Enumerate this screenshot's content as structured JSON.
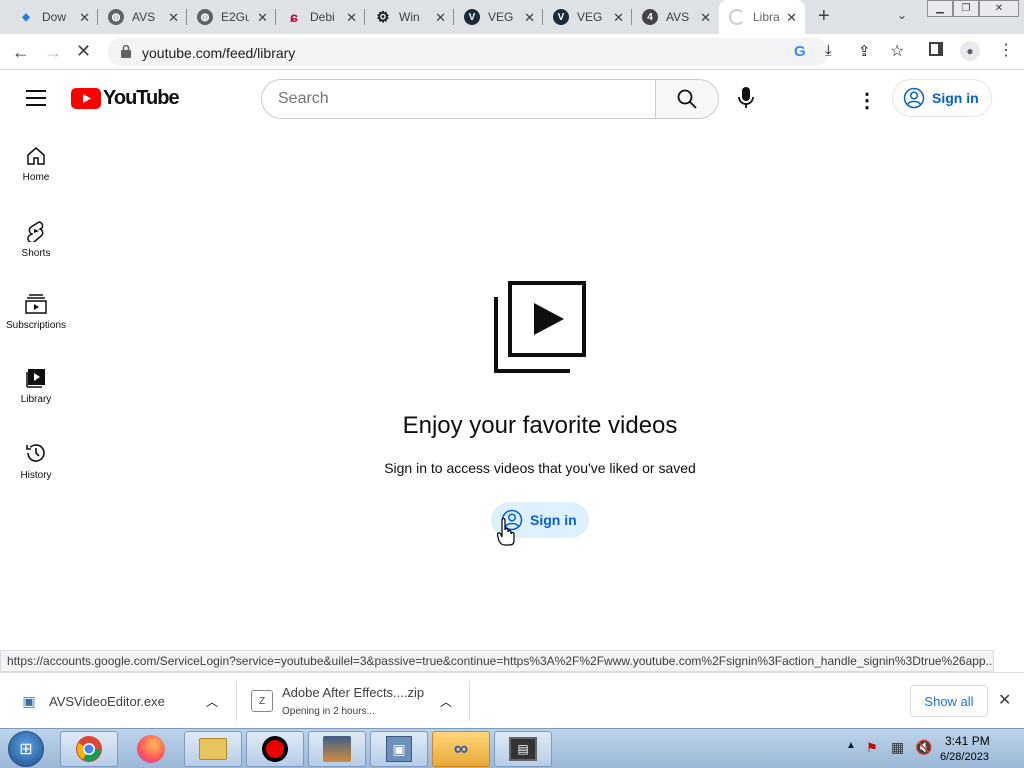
{
  "tabs": [
    {
      "title": "Dow",
      "icon": "diamond-icon",
      "color": "#2b7bd8"
    },
    {
      "title": "AVS",
      "icon": "globe-icon",
      "color": "#5f6368"
    },
    {
      "title": "E2Gu",
      "icon": "globe-icon",
      "color": "#5f6368"
    },
    {
      "title": "Debi",
      "icon": "debian-swirl-icon",
      "color": "#c70036"
    },
    {
      "title": "Win",
      "icon": "gear-icon",
      "color": "#202124"
    },
    {
      "title": "VEG",
      "icon": "vegas-icon",
      "color": "#1b2a3a"
    },
    {
      "title": "VEG",
      "icon": "vegas-icon",
      "color": "#1b2a3a"
    },
    {
      "title": "AVS",
      "icon": "number4-icon",
      "color": "#444"
    },
    {
      "title": "Libra",
      "icon": "loading-spinner-icon",
      "color": "#bbb"
    }
  ],
  "address": {
    "url": "youtube.com/feed/library",
    "status_url": "https://accounts.google.com/ServiceLogin?service=youtube&uilel=3&passive=true&continue=https%3A%2F%2Fwww.youtube.com%2Fsignin%3Faction_handle_signin%3Dtrue%26app..."
  },
  "youtube": {
    "logo_text": "YouTube",
    "search_placeholder": "Search",
    "signin_label": "Sign in",
    "brand_red": "#ff0000",
    "link_blue": "#065fd4"
  },
  "sidenav": [
    {
      "label": "Home",
      "icon": "home-icon"
    },
    {
      "label": "Shorts",
      "icon": "shorts-icon"
    },
    {
      "label": "Subscriptions",
      "icon": "subscriptions-icon"
    },
    {
      "label": "Library",
      "icon": "library-icon"
    },
    {
      "label": "History",
      "icon": "history-icon"
    }
  ],
  "main": {
    "title": "Enjoy your favorite videos",
    "subtitle": "Sign in to access videos that you've liked or saved",
    "signin_label": "Sign in"
  },
  "downloads": {
    "items": [
      {
        "name": "AVSVideoEditor.exe",
        "status": ""
      },
      {
        "name": "Adobe After Effects....zip",
        "status": "Opening in 2 hours..."
      }
    ],
    "show_all": "Show all"
  },
  "taskbar": {
    "time": "3:41 PM",
    "date": "6/28/2023"
  }
}
